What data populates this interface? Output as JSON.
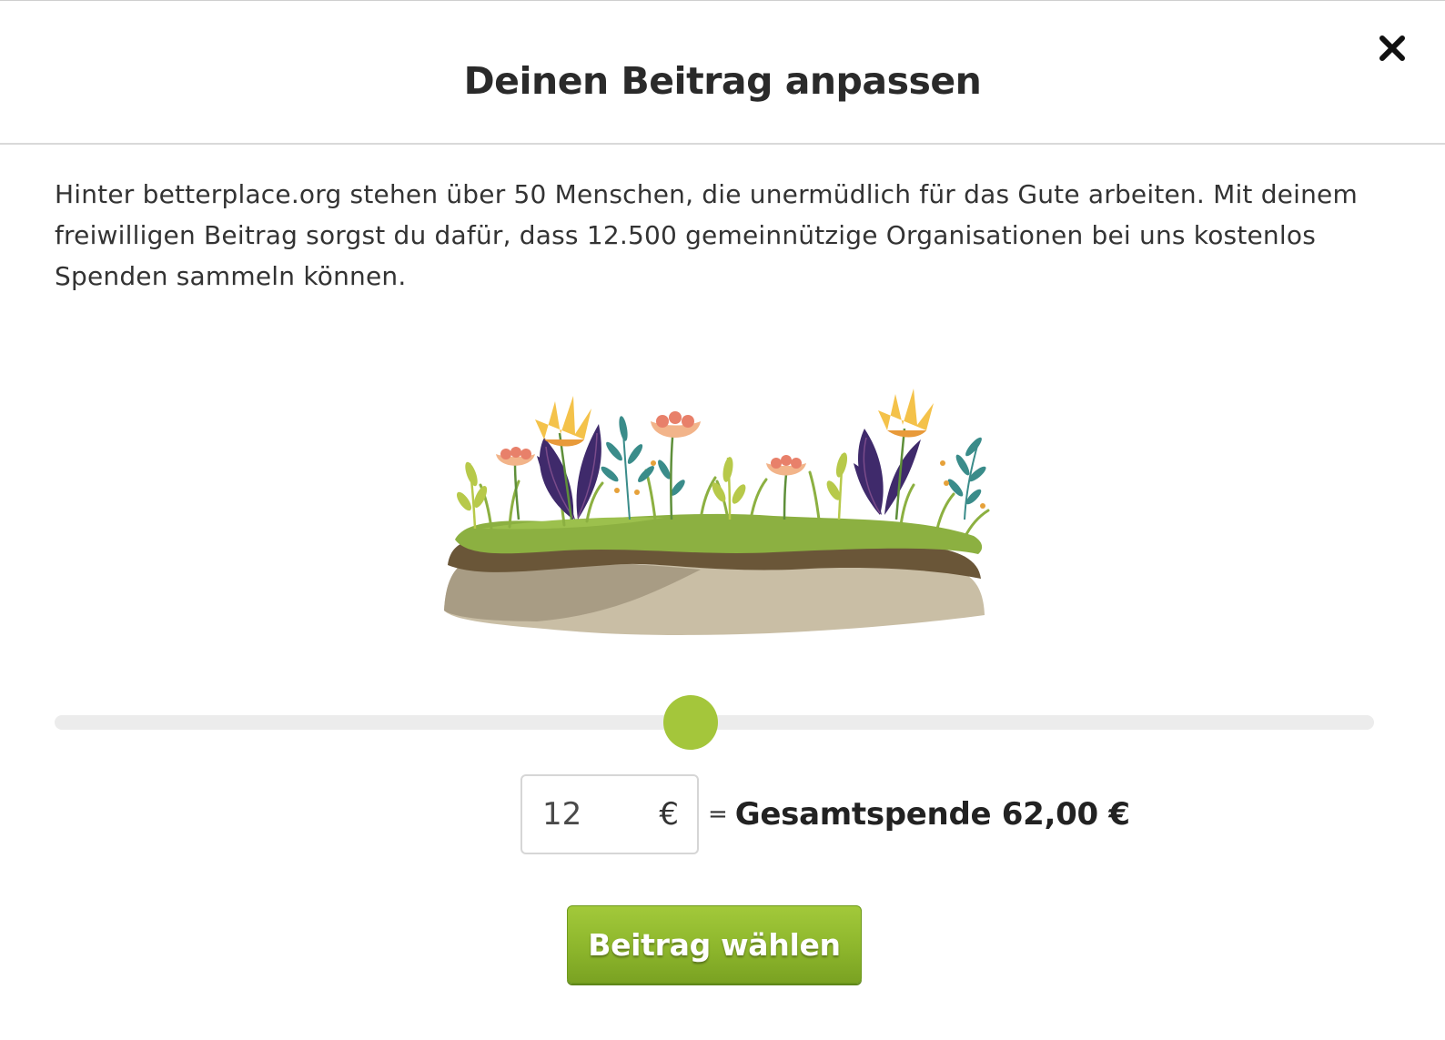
{
  "dialog": {
    "title": "Deinen Beitrag anpassen",
    "close_icon": "close-icon",
    "intro_text": "Hinter betterplace.org stehen über 50 Menschen, die unermüdlich für das Gute arbeiten. Mit deinem freiwilligen Beitrag sorgst du dafür, dass 12.500 gemeinnützige Organisationen bei uns kostenlos Spenden sammeln können."
  },
  "illustration": {
    "icon": "flower-meadow-illustration"
  },
  "slider": {
    "level": 0.482
  },
  "amount": {
    "value": "12",
    "currency": "€",
    "equals": "=",
    "total_label": "Gesamtspende 62,00 €"
  },
  "submit": {
    "label": "Beitrag wählen"
  },
  "colors": {
    "accent": "#a4c63b",
    "button_top": "#a2c93a",
    "button_bottom": "#7aa222",
    "track": "#ececec"
  }
}
